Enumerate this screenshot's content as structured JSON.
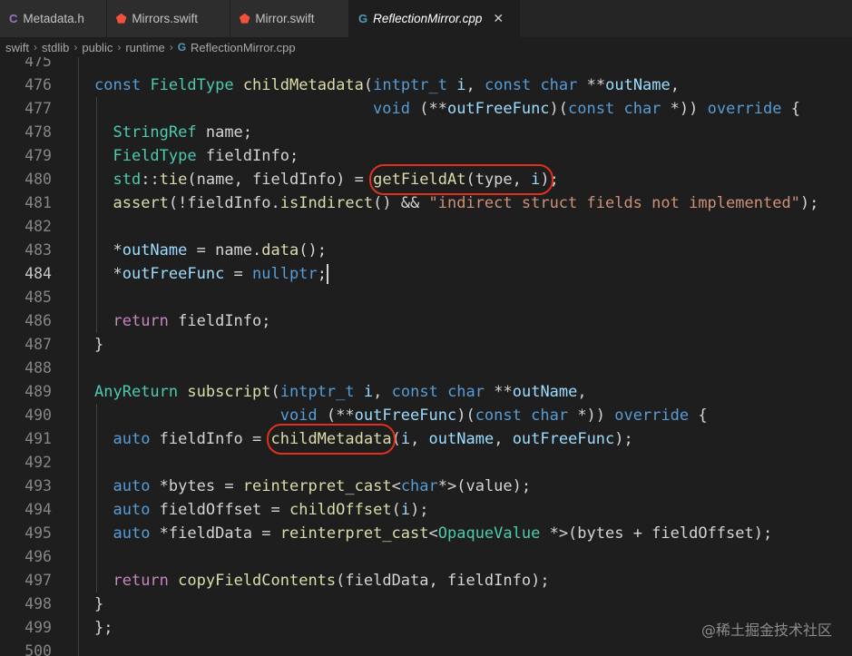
{
  "tabs": [
    {
      "icon": "C",
      "label": "Metadata.h"
    },
    {
      "icon": "⬟",
      "label": "Mirrors.swift"
    },
    {
      "icon": "⬟",
      "label": "Mirror.swift"
    },
    {
      "icon": "G",
      "label": "ReflectionMirror.cpp",
      "close": "✕"
    }
  ],
  "breadcrumb": [
    "swift",
    "stdlib",
    "public",
    "runtime",
    "ReflectionMirror.cpp"
  ],
  "breadcrumb_sep": "›",
  "editor": {
    "current_line": "484",
    "lines": [
      {
        "n": "475",
        "t": ""
      },
      {
        "n": "476",
        "t": "const FieldType childMetadata(intptr_t i, const char **outName,"
      },
      {
        "n": "477",
        "t": "                              void (**outFreeFunc)(const char *)) override {"
      },
      {
        "n": "478",
        "t": "  StringRef name;"
      },
      {
        "n": "479",
        "t": "  FieldType fieldInfo;"
      },
      {
        "n": "480",
        "t": "  std::tie(name, fieldInfo) = getFieldAt(type, i);"
      },
      {
        "n": "481",
        "t": "  assert(!fieldInfo.isIndirect() && \"indirect struct fields not implemented\");"
      },
      {
        "n": "482",
        "t": ""
      },
      {
        "n": "483",
        "t": "  *outName = name.data();"
      },
      {
        "n": "484",
        "t": "  *outFreeFunc = nullptr;"
      },
      {
        "n": "485",
        "t": ""
      },
      {
        "n": "486",
        "t": "  return fieldInfo;"
      },
      {
        "n": "487",
        "t": "}"
      },
      {
        "n": "488",
        "t": ""
      },
      {
        "n": "489",
        "t": "AnyReturn subscript(intptr_t i, const char **outName,"
      },
      {
        "n": "490",
        "t": "                    void (**outFreeFunc)(const char *)) override {"
      },
      {
        "n": "491",
        "t": "  auto fieldInfo = childMetadata(i, outName, outFreeFunc);"
      },
      {
        "n": "492",
        "t": ""
      },
      {
        "n": "493",
        "t": "  auto *bytes = reinterpret_cast<char*>(value);"
      },
      {
        "n": "494",
        "t": "  auto fieldOffset = childOffset(i);"
      },
      {
        "n": "495",
        "t": "  auto *fieldData = reinterpret_cast<OpaqueValue *>(bytes + fieldOffset);"
      },
      {
        "n": "496",
        "t": ""
      },
      {
        "n": "497",
        "t": "  return copyFieldContents(fieldData, fieldInfo);"
      },
      {
        "n": "498",
        "t": "}"
      },
      {
        "n": "499",
        "t": "};"
      },
      {
        "n": "500",
        "t": ""
      }
    ]
  },
  "watermark": "@稀土掘金技术社区",
  "colors": {
    "highlight_circle": "#e0301e",
    "background": "#1e1e1e"
  }
}
